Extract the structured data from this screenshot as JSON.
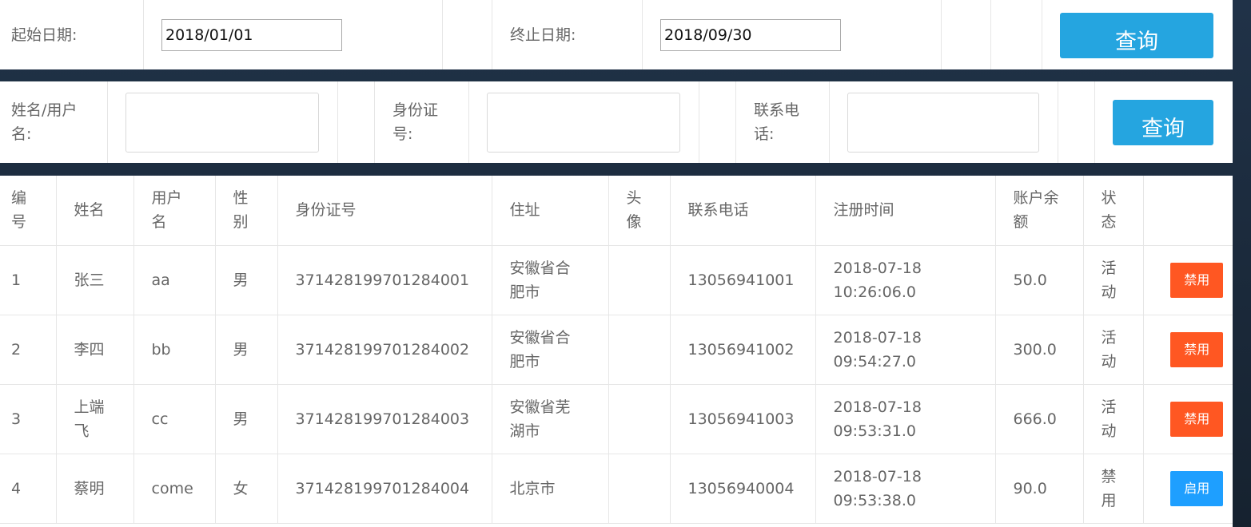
{
  "date_filter": {
    "start_label": "起始日期:",
    "start_value": "2018/01/01",
    "end_label": "终止日期:",
    "end_value": "2018/09/30",
    "query_label": "查询"
  },
  "user_filter": {
    "name_label_1": "姓名/用户",
    "name_label_2": "名:",
    "id_label_1": "身份证",
    "id_label_2": "号:",
    "phone_label_1": "联系电",
    "phone_label_2": "话:",
    "query_label": "查询"
  },
  "table": {
    "headers": {
      "id_1": "编",
      "id_2": "号",
      "name": "姓名",
      "username_1": "用户",
      "username_2": "名",
      "gender_1": "性",
      "gender_2": "别",
      "idcard": "身份证号",
      "address": "住址",
      "avatar_1": "头",
      "avatar_2": "像",
      "phone": "联系电话",
      "regtime": "注册时间",
      "balance_1": "账户余",
      "balance_2": "额",
      "status_1": "状",
      "status_2": "态"
    },
    "rows": [
      {
        "id": "1",
        "name_1": "张三",
        "name_2": "",
        "username": "aa",
        "gender": "男",
        "idcard": "371428199701284001",
        "address_1": "安徽省合",
        "address_2": "肥市",
        "phone": "13056941001",
        "reg_date": "2018-07-18",
        "reg_time": "10:26:06.0",
        "balance": "50.0",
        "status_1": "活",
        "status_2": "动",
        "action": "禁用",
        "action_type": "disable"
      },
      {
        "id": "2",
        "name_1": "李四",
        "name_2": "",
        "username": "bb",
        "gender": "男",
        "idcard": "371428199701284002",
        "address_1": "安徽省合",
        "address_2": "肥市",
        "phone": "13056941002",
        "reg_date": "2018-07-18",
        "reg_time": "09:54:27.0",
        "balance": "300.0",
        "status_1": "活",
        "status_2": "动",
        "action": "禁用",
        "action_type": "disable"
      },
      {
        "id": "3",
        "name_1": "上端",
        "name_2": "飞",
        "username": "cc",
        "gender": "男",
        "idcard": "371428199701284003",
        "address_1": "安徽省芜",
        "address_2": "湖市",
        "phone": "13056941003",
        "reg_date": "2018-07-18",
        "reg_time": "09:53:31.0",
        "balance": "666.0",
        "status_1": "活",
        "status_2": "动",
        "action": "禁用",
        "action_type": "disable"
      },
      {
        "id": "4",
        "name_1": "蔡明",
        "name_2": "",
        "username": "come",
        "gender": "女",
        "idcard": "371428199701284004",
        "address_1": "北京市",
        "address_2": "",
        "phone": "13056940004",
        "reg_date": "2018-07-18",
        "reg_time": "09:53:38.0",
        "balance": "90.0",
        "status_1": "禁",
        "status_2": "用",
        "action": "启用",
        "action_type": "enable"
      }
    ]
  },
  "colors": {
    "query_button": "#25a5e0",
    "disable_button": "#ff5722",
    "enable_button": "#1e9fff"
  }
}
